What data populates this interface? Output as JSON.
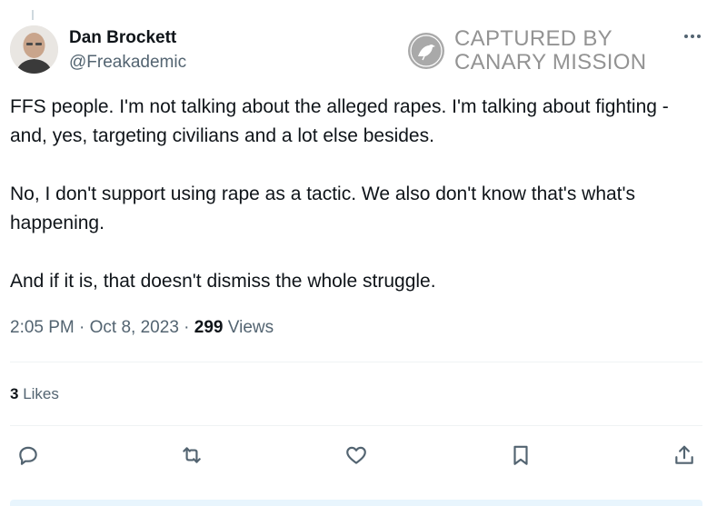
{
  "tweet": {
    "author": {
      "name": "Dan Brockett",
      "handle": "@Freakademic"
    },
    "paragraphs": [
      "FFS people. I'm not talking about the alleged rapes. I'm talking about fighting - and, yes, targeting civilians and a lot else besides.",
      "No, I don't support using rape as a tactic. We also don't know that's what's happening.",
      "And if it is, that doesn't dismiss the whole struggle."
    ],
    "time": "2:05 PM",
    "date": "Oct 8, 2023",
    "separator": "·",
    "views_count": "299",
    "views_label": "Views",
    "likes_count": "3",
    "likes_label": "Likes"
  },
  "watermark": {
    "line1": "CAPTURED BY",
    "line2": "CANARY MISSION"
  },
  "actions": {
    "reply": "reply-icon",
    "retweet": "retweet-icon",
    "like": "heart-icon",
    "bookmark": "bookmark-icon",
    "share": "share-icon"
  },
  "colors": {
    "text": "#0f1419",
    "secondary": "#536471",
    "divider": "#eff3f4"
  }
}
